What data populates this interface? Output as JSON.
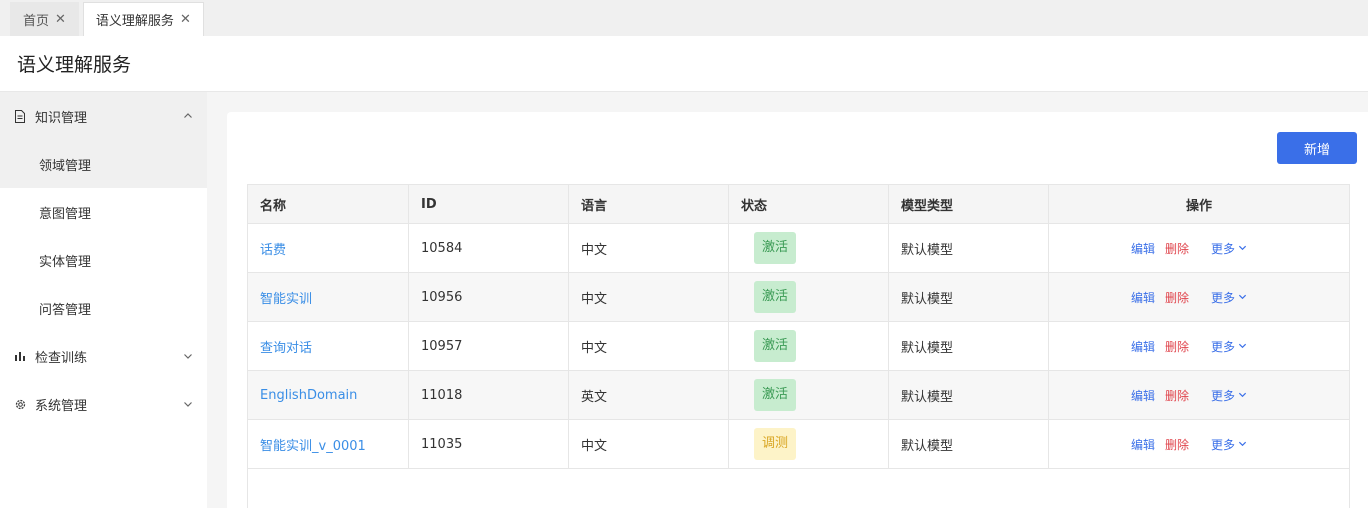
{
  "tabs": [
    {
      "label": "首页"
    },
    {
      "label": "语义理解服务"
    }
  ],
  "page": {
    "title": "语义理解服务"
  },
  "sidebar": {
    "groups": [
      {
        "label": "知识管理",
        "icon": "document-icon",
        "items": [
          "领域管理",
          "意图管理",
          "实体管理",
          "问答管理"
        ]
      },
      {
        "label": "检查训练",
        "icon": "bar-chart-icon"
      },
      {
        "label": "系统管理",
        "icon": "gear-icon"
      }
    ]
  },
  "toolbar": {
    "add_label": "新增"
  },
  "table": {
    "headers": [
      "名称",
      "ID",
      "语言",
      "状态",
      "模型类型",
      "操作"
    ],
    "rows": [
      {
        "name": "话费",
        "id": "10584",
        "lang": "中文",
        "status": "激活",
        "model": "默认模型"
      },
      {
        "name": "智能实训",
        "id": "10956",
        "lang": "中文",
        "status": "激活",
        "model": "默认模型"
      },
      {
        "name": "查询对话",
        "id": "10957",
        "lang": "中文",
        "status": "激活",
        "model": "默认模型"
      },
      {
        "name": "EnglishDomain",
        "id": "11018",
        "lang": "英文",
        "status": "激活",
        "model": "默认模型"
      },
      {
        "name": "智能实训_v_0001",
        "id": "11035",
        "lang": "中文",
        "status": "调测",
        "model": "默认模型"
      }
    ],
    "actions": {
      "edit": "编辑",
      "delete": "删除",
      "more": "更多"
    }
  },
  "colors": {
    "accent": "#3a6fe8",
    "link": "#3a8ee6",
    "danger": "#e0444c",
    "status_active_bg": "#c7eccf",
    "status_test_bg": "#fdf3c8"
  }
}
